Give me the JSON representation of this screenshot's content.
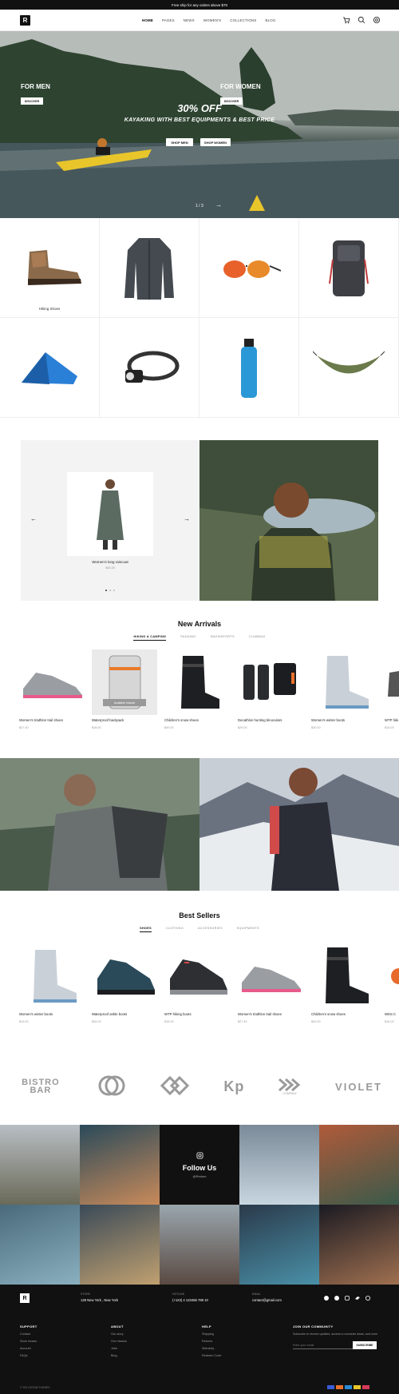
{
  "topbar": {
    "text": "Free ship for any orders above $70"
  },
  "nav": {
    "logo": "R",
    "links": [
      "HOME",
      "PAGES",
      "NEWS",
      "WOMEN'S",
      "COLLECTIONS",
      "BLOG"
    ]
  },
  "hero": {
    "title": "30% OFF",
    "subtitle": "KAYAKING WITH BEST EQUIPMENTS & BEST PRICE",
    "btn_men": "SHOP MEN",
    "btn_women": "SHOP WOMEN",
    "slide": "1 / 3"
  },
  "categories": {
    "first_label": "Hiking Shoes"
  },
  "showcase": {
    "product_name": "Women's long raincoat",
    "product_price": "$45.00"
  },
  "new_arrivals": {
    "title": "New Arrivals",
    "tabs": [
      "HIKING & CAMPING",
      "PADDING",
      "SNOWSPORTS",
      "CLIMBING"
    ],
    "products": [
      {
        "name": "Women's triathlon trail shoes",
        "price": "$27.40"
      },
      {
        "name": "Waterproof backpack",
        "price": "$16.00"
      },
      {
        "name": "Children's snow shoes",
        "price": "$40.00"
      },
      {
        "name": "Decathlon hunting binoculars",
        "price": "$29.00"
      },
      {
        "name": "Women's winter boots",
        "price": "$30.00"
      },
      {
        "name": "WTP hiki",
        "price": "$16.00"
      }
    ],
    "badge": "Available Instock"
  },
  "banners": {
    "men_title": "FOR MEN",
    "women_title": "FOR WOMEN",
    "discover": "DISCOVER"
  },
  "best_sellers": {
    "title": "Best Sellers",
    "tabs": [
      "SHOES",
      "CLOTHING",
      "ACCESSORIES",
      "EQUIPMENTS"
    ],
    "products": [
      {
        "name": "Women's winter boots",
        "price": "$19.00"
      },
      {
        "name": "Waterproof ankle boots",
        "price": "$26.00"
      },
      {
        "name": "WTP hiking boots",
        "price": "$16.00"
      },
      {
        "name": "Women's triathlon trail shoes",
        "price": "$27.40"
      },
      {
        "name": "Children's snow shoes",
        "price": "$40.00"
      },
      {
        "name": "Wrist C",
        "price": "$16.00"
      }
    ]
  },
  "brands": [
    "BISTRO BAR",
    "",
    "",
    "Kp",
    "COMPANY",
    "VIOLET"
  ],
  "instagram": {
    "title": "Follow Us",
    "handle": "@Redom"
  },
  "footer": {
    "store_label": "STORE",
    "store_value": "128 New York , New York",
    "hotline_label": "HOTLINE",
    "hotline_value": "(+123) 4 123456 789 10",
    "email_label": "EMAIL",
    "email_value": "contact@gmail.com",
    "support_title": "SUPPORT",
    "support_items": [
      "Contact",
      "Store locator",
      "Account",
      "FAQs"
    ],
    "about_title": "ABOUT",
    "about_items": [
      "Our story",
      "Our mission",
      "Jobs",
      "Blog"
    ],
    "help_title": "HELP",
    "help_items": [
      "Shipping",
      "Returns",
      "Warranty",
      "Redeem Code"
    ],
    "community_title": "JOIN OUR COMMUNITY",
    "community_text": "Subscribe to receive updates, access to exclusive deals, and more.",
    "email_placeholder": "Enter your email",
    "subscribe": "SUBSCRIBE",
    "copyright": "© 2021 ROOM THEMES"
  }
}
